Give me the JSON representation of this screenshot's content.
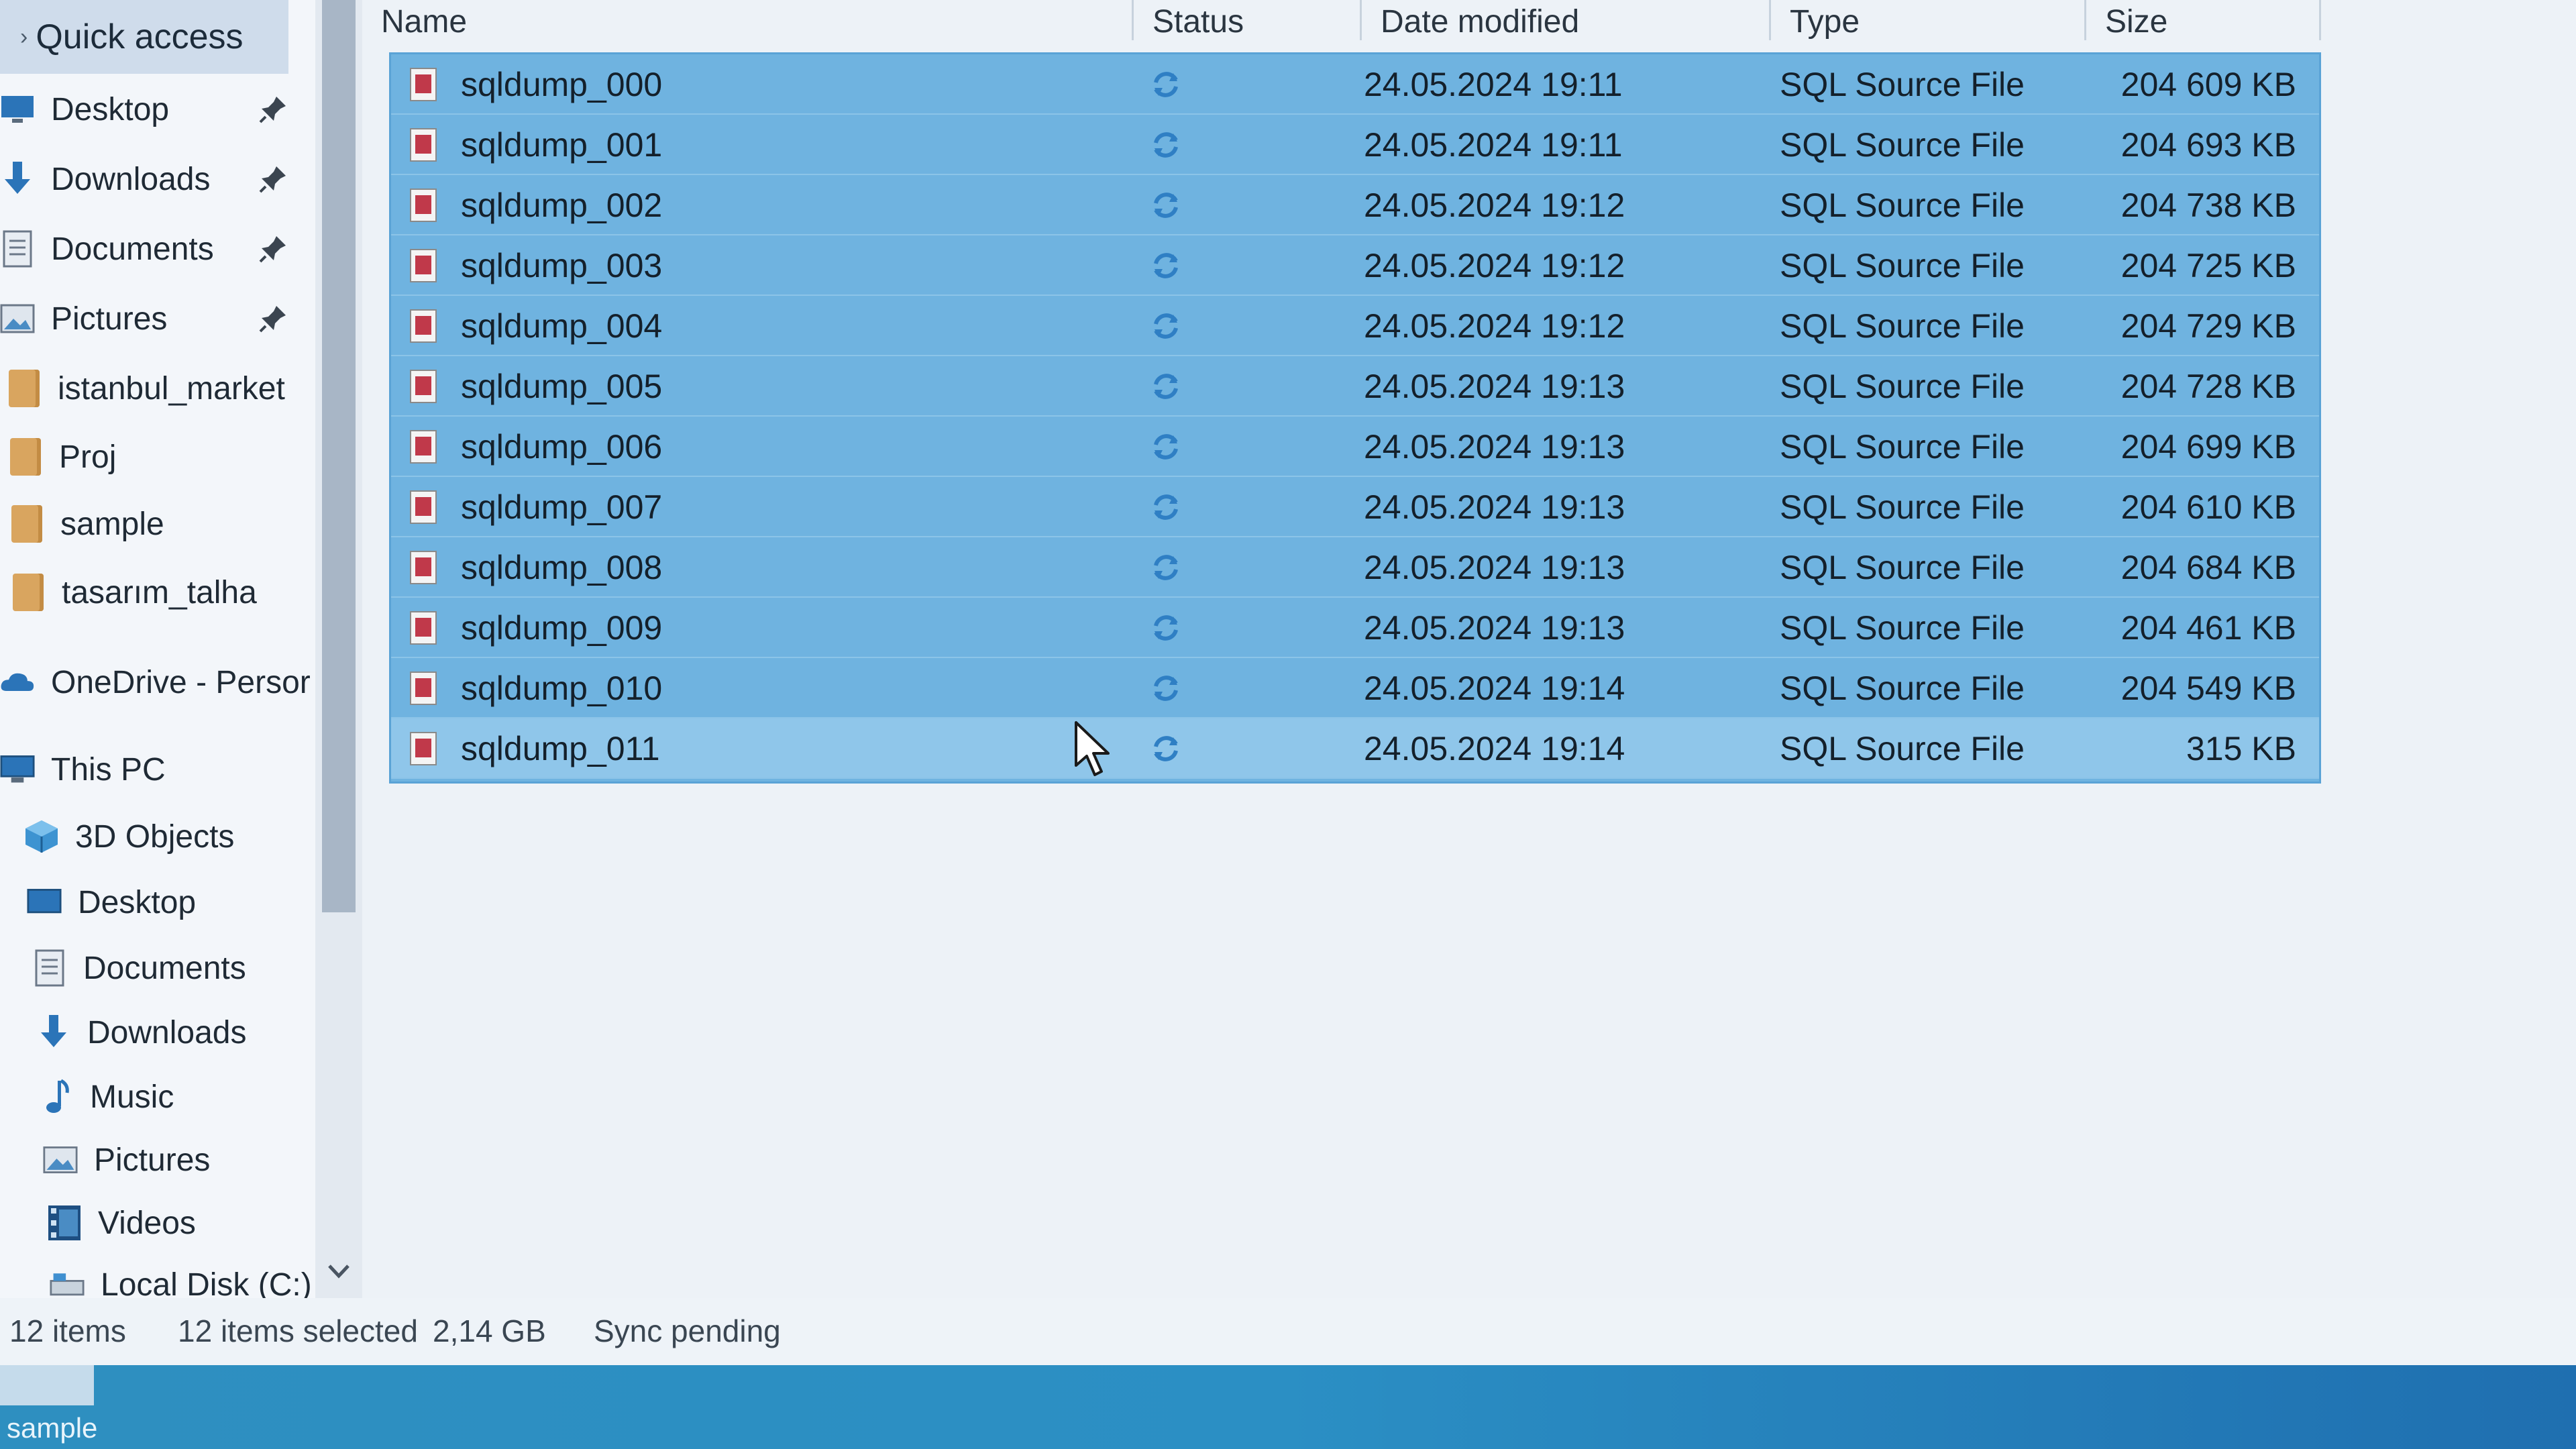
{
  "nav": {
    "quick_access": "Quick access",
    "quick_items": [
      {
        "label": "Desktop",
        "icon": "desktop-icon",
        "pinned": true
      },
      {
        "label": "Downloads",
        "icon": "download-arrow-icon",
        "pinned": true
      },
      {
        "label": "Documents",
        "icon": "documents-icon",
        "pinned": true
      },
      {
        "label": "Pictures",
        "icon": "pictures-icon",
        "pinned": true
      },
      {
        "label": "istanbul_market",
        "icon": "folder-icon",
        "pinned": false
      },
      {
        "label": "Proj",
        "icon": "folder-icon",
        "pinned": false
      },
      {
        "label": "sample",
        "icon": "folder-icon",
        "pinned": false
      },
      {
        "label": "tasarım_talha",
        "icon": "folder-icon",
        "pinned": false
      }
    ],
    "onedrive": "OneDrive - Persor",
    "this_pc": "This PC",
    "pc_items": [
      {
        "label": "3D Objects",
        "icon": "3d-objects-icon"
      },
      {
        "label": "Desktop",
        "icon": "desktop-icon"
      },
      {
        "label": "Documents",
        "icon": "documents-icon"
      },
      {
        "label": "Downloads",
        "icon": "download-arrow-icon"
      },
      {
        "label": "Music",
        "icon": "music-note-icon"
      },
      {
        "label": "Pictures",
        "icon": "pictures-icon"
      },
      {
        "label": "Videos",
        "icon": "videos-icon"
      },
      {
        "label": "Local Disk (C:)",
        "icon": "drive-icon"
      }
    ]
  },
  "columns": {
    "name": "Name",
    "status": "Status",
    "date": "Date modified",
    "type": "Type",
    "size": "Size"
  },
  "files": [
    {
      "name": "sqldump_000",
      "date": "24.05.2024 19:11",
      "type": "SQL Source File",
      "size": "204 609 KB"
    },
    {
      "name": "sqldump_001",
      "date": "24.05.2024 19:11",
      "type": "SQL Source File",
      "size": "204 693 KB"
    },
    {
      "name": "sqldump_002",
      "date": "24.05.2024 19:12",
      "type": "SQL Source File",
      "size": "204 738 KB"
    },
    {
      "name": "sqldump_003",
      "date": "24.05.2024 19:12",
      "type": "SQL Source File",
      "size": "204 725 KB"
    },
    {
      "name": "sqldump_004",
      "date": "24.05.2024 19:12",
      "type": "SQL Source File",
      "size": "204 729 KB"
    },
    {
      "name": "sqldump_005",
      "date": "24.05.2024 19:13",
      "type": "SQL Source File",
      "size": "204 728 KB"
    },
    {
      "name": "sqldump_006",
      "date": "24.05.2024 19:13",
      "type": "SQL Source File",
      "size": "204 699 KB"
    },
    {
      "name": "sqldump_007",
      "date": "24.05.2024 19:13",
      "type": "SQL Source File",
      "size": "204 610 KB"
    },
    {
      "name": "sqldump_008",
      "date": "24.05.2024 19:13",
      "type": "SQL Source File",
      "size": "204 684 KB"
    },
    {
      "name": "sqldump_009",
      "date": "24.05.2024 19:13",
      "type": "SQL Source File",
      "size": "204 461 KB"
    },
    {
      "name": "sqldump_010",
      "date": "24.05.2024 19:14",
      "type": "SQL Source File",
      "size": "204 549 KB"
    },
    {
      "name": "sqldump_011",
      "date": "24.05.2024 19:14",
      "type": "SQL Source File",
      "size": "315 KB"
    }
  ],
  "status_icon": "sync-pending-icon",
  "statusbar": {
    "items": "12 items",
    "selected": "12 items selected",
    "selected_size": "2,14 GB",
    "sync": "Sync pending"
  },
  "taskbar": {
    "label": "sample"
  },
  "colors": {
    "selection": "#6fb3e0",
    "sync_icon": "#2f7fc4",
    "sql_icon": "#c0394a"
  }
}
